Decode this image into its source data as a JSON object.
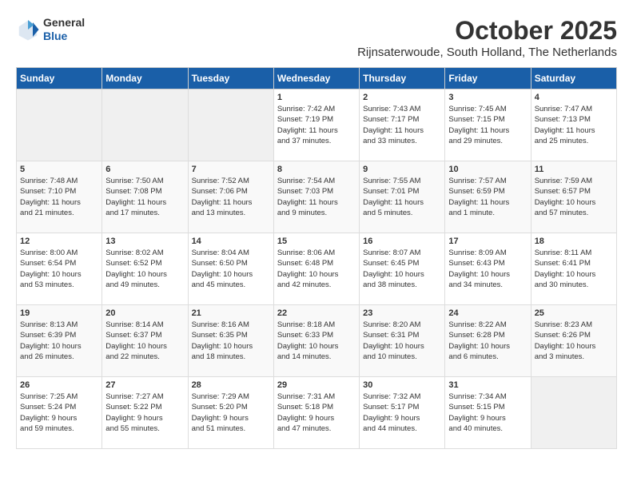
{
  "header": {
    "logo_line1": "General",
    "logo_line2": "Blue",
    "month": "October 2025",
    "location": "Rijnsaterwoude, South Holland, The Netherlands"
  },
  "weekdays": [
    "Sunday",
    "Monday",
    "Tuesday",
    "Wednesday",
    "Thursday",
    "Friday",
    "Saturday"
  ],
  "weeks": [
    [
      {
        "day": "",
        "info": ""
      },
      {
        "day": "",
        "info": ""
      },
      {
        "day": "",
        "info": ""
      },
      {
        "day": "1",
        "info": "Sunrise: 7:42 AM\nSunset: 7:19 PM\nDaylight: 11 hours\nand 37 minutes."
      },
      {
        "day": "2",
        "info": "Sunrise: 7:43 AM\nSunset: 7:17 PM\nDaylight: 11 hours\nand 33 minutes."
      },
      {
        "day": "3",
        "info": "Sunrise: 7:45 AM\nSunset: 7:15 PM\nDaylight: 11 hours\nand 29 minutes."
      },
      {
        "day": "4",
        "info": "Sunrise: 7:47 AM\nSunset: 7:13 PM\nDaylight: 11 hours\nand 25 minutes."
      }
    ],
    [
      {
        "day": "5",
        "info": "Sunrise: 7:48 AM\nSunset: 7:10 PM\nDaylight: 11 hours\nand 21 minutes."
      },
      {
        "day": "6",
        "info": "Sunrise: 7:50 AM\nSunset: 7:08 PM\nDaylight: 11 hours\nand 17 minutes."
      },
      {
        "day": "7",
        "info": "Sunrise: 7:52 AM\nSunset: 7:06 PM\nDaylight: 11 hours\nand 13 minutes."
      },
      {
        "day": "8",
        "info": "Sunrise: 7:54 AM\nSunset: 7:03 PM\nDaylight: 11 hours\nand 9 minutes."
      },
      {
        "day": "9",
        "info": "Sunrise: 7:55 AM\nSunset: 7:01 PM\nDaylight: 11 hours\nand 5 minutes."
      },
      {
        "day": "10",
        "info": "Sunrise: 7:57 AM\nSunset: 6:59 PM\nDaylight: 11 hours\nand 1 minute."
      },
      {
        "day": "11",
        "info": "Sunrise: 7:59 AM\nSunset: 6:57 PM\nDaylight: 10 hours\nand 57 minutes."
      }
    ],
    [
      {
        "day": "12",
        "info": "Sunrise: 8:00 AM\nSunset: 6:54 PM\nDaylight: 10 hours\nand 53 minutes."
      },
      {
        "day": "13",
        "info": "Sunrise: 8:02 AM\nSunset: 6:52 PM\nDaylight: 10 hours\nand 49 minutes."
      },
      {
        "day": "14",
        "info": "Sunrise: 8:04 AM\nSunset: 6:50 PM\nDaylight: 10 hours\nand 45 minutes."
      },
      {
        "day": "15",
        "info": "Sunrise: 8:06 AM\nSunset: 6:48 PM\nDaylight: 10 hours\nand 42 minutes."
      },
      {
        "day": "16",
        "info": "Sunrise: 8:07 AM\nSunset: 6:45 PM\nDaylight: 10 hours\nand 38 minutes."
      },
      {
        "day": "17",
        "info": "Sunrise: 8:09 AM\nSunset: 6:43 PM\nDaylight: 10 hours\nand 34 minutes."
      },
      {
        "day": "18",
        "info": "Sunrise: 8:11 AM\nSunset: 6:41 PM\nDaylight: 10 hours\nand 30 minutes."
      }
    ],
    [
      {
        "day": "19",
        "info": "Sunrise: 8:13 AM\nSunset: 6:39 PM\nDaylight: 10 hours\nand 26 minutes."
      },
      {
        "day": "20",
        "info": "Sunrise: 8:14 AM\nSunset: 6:37 PM\nDaylight: 10 hours\nand 22 minutes."
      },
      {
        "day": "21",
        "info": "Sunrise: 8:16 AM\nSunset: 6:35 PM\nDaylight: 10 hours\nand 18 minutes."
      },
      {
        "day": "22",
        "info": "Sunrise: 8:18 AM\nSunset: 6:33 PM\nDaylight: 10 hours\nand 14 minutes."
      },
      {
        "day": "23",
        "info": "Sunrise: 8:20 AM\nSunset: 6:31 PM\nDaylight: 10 hours\nand 10 minutes."
      },
      {
        "day": "24",
        "info": "Sunrise: 8:22 AM\nSunset: 6:28 PM\nDaylight: 10 hours\nand 6 minutes."
      },
      {
        "day": "25",
        "info": "Sunrise: 8:23 AM\nSunset: 6:26 PM\nDaylight: 10 hours\nand 3 minutes."
      }
    ],
    [
      {
        "day": "26",
        "info": "Sunrise: 7:25 AM\nSunset: 5:24 PM\nDaylight: 9 hours\nand 59 minutes."
      },
      {
        "day": "27",
        "info": "Sunrise: 7:27 AM\nSunset: 5:22 PM\nDaylight: 9 hours\nand 55 minutes."
      },
      {
        "day": "28",
        "info": "Sunrise: 7:29 AM\nSunset: 5:20 PM\nDaylight: 9 hours\nand 51 minutes."
      },
      {
        "day": "29",
        "info": "Sunrise: 7:31 AM\nSunset: 5:18 PM\nDaylight: 9 hours\nand 47 minutes."
      },
      {
        "day": "30",
        "info": "Sunrise: 7:32 AM\nSunset: 5:17 PM\nDaylight: 9 hours\nand 44 minutes."
      },
      {
        "day": "31",
        "info": "Sunrise: 7:34 AM\nSunset: 5:15 PM\nDaylight: 9 hours\nand 40 minutes."
      },
      {
        "day": "",
        "info": ""
      }
    ]
  ]
}
